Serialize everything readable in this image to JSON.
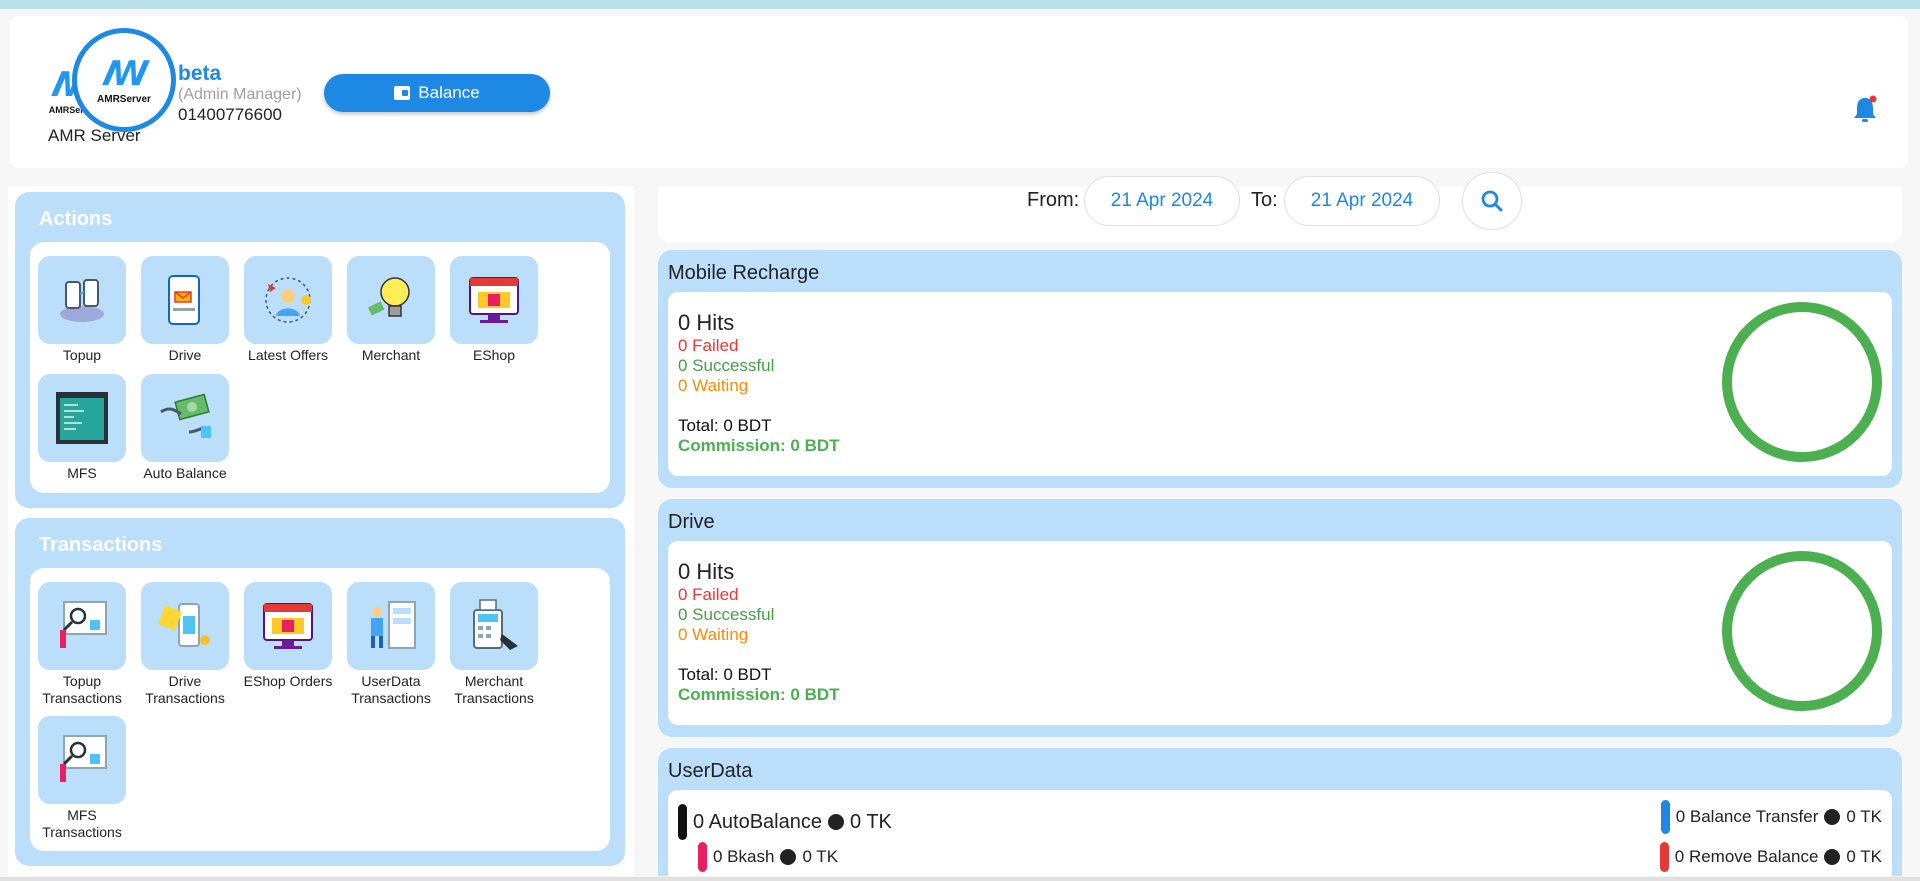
{
  "header": {
    "logo_text": "AMRServer",
    "app_name": "AMR Server",
    "user_name": "beta",
    "user_role": "(Admin Manager)",
    "user_phone": "01400776600",
    "balance_label": "Balance",
    "bell_icon": "bell-icon"
  },
  "actions": {
    "title": "Actions",
    "items": [
      {
        "label": "Topup",
        "icon": "topup-icon"
      },
      {
        "label": "Drive",
        "icon": "drive-icon"
      },
      {
        "label": "Latest Offers",
        "icon": "offers-icon"
      },
      {
        "label": "Merchant",
        "icon": "merchant-icon"
      },
      {
        "label": "EShop",
        "icon": "eshop-icon"
      },
      {
        "label": "MFS",
        "icon": "mfs-icon"
      },
      {
        "label": "Auto Balance",
        "icon": "auto-balance-icon"
      }
    ]
  },
  "transactions": {
    "title": "Transactions",
    "items": [
      {
        "label": "Topup Transactions",
        "icon": "topup-transactions-icon"
      },
      {
        "label": "Drive Transactions",
        "icon": "drive-transactions-icon"
      },
      {
        "label": "EShop Orders",
        "icon": "eshop-orders-icon"
      },
      {
        "label": "UserData Transactions",
        "icon": "userdata-transactions-icon"
      },
      {
        "label": "Merchant Transactions",
        "icon": "merchant-transactions-icon"
      },
      {
        "label": "MFS Transactions",
        "icon": "mfs-transactions-icon"
      }
    ]
  },
  "filter": {
    "from_label": "From:",
    "from_value": "21 Apr 2024",
    "to_label": "To:",
    "to_value": "21 Apr 2024",
    "search_icon": "search-icon"
  },
  "cards": {
    "mobile_recharge": {
      "title": "Mobile Recharge",
      "hits": "0 Hits",
      "failed": "0 Failed",
      "successful": "0 Successful",
      "waiting": "0 Waiting",
      "total": "Total: 0 BDT",
      "commission": "Commission: 0 BDT"
    },
    "drive": {
      "title": "Drive",
      "hits": "0 Hits",
      "failed": "0 Failed",
      "successful": "0 Successful",
      "waiting": "0 Waiting",
      "total": "Total: 0 BDT",
      "commission": "Commission: 0 BDT"
    },
    "userdata": {
      "title": "UserData",
      "auto_balance": "0 AutoBalance",
      "auto_balance_tk": "0 TK",
      "bkash": "0 Bkash",
      "bkash_tk": "0 TK",
      "balance_transfer": "0 Balance Transfer",
      "balance_transfer_tk": "0 TK",
      "remove_balance": "0 Remove Balance",
      "remove_balance_tk": "0 TK"
    }
  },
  "colors": {
    "accent": "#1e88e5",
    "panel": "#bbdefb",
    "failed": "#e53935",
    "success": "#43a047",
    "waiting": "#fb8c00",
    "ring": "#4caf50"
  }
}
